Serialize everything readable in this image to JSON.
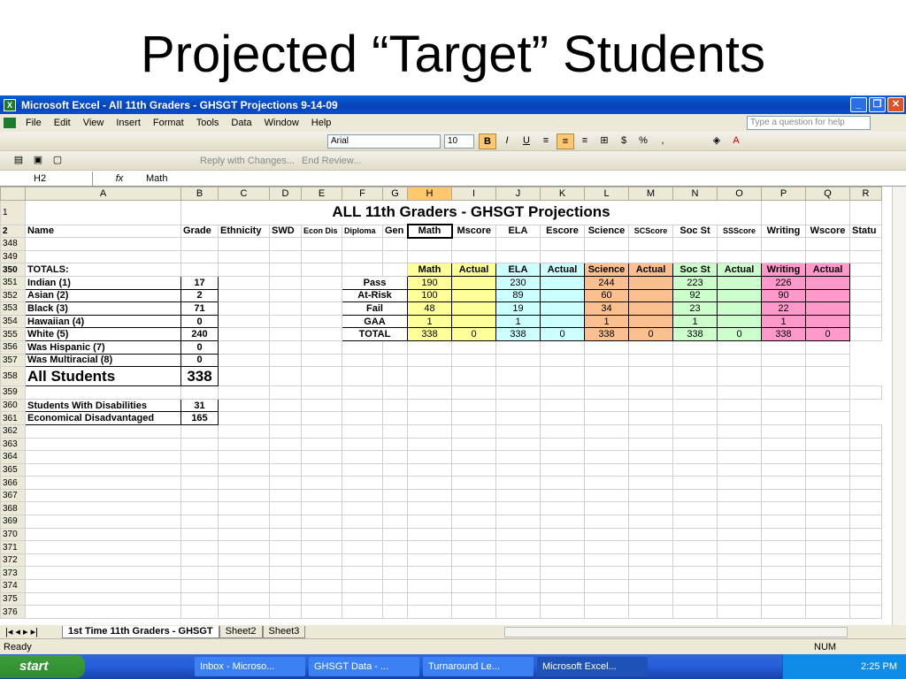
{
  "slide": {
    "title": "Projected “Target” Students"
  },
  "window": {
    "title": "Microsoft Excel - All 11th Graders - GHSGT Projections 9-14-09"
  },
  "menu": {
    "items": [
      "File",
      "Edit",
      "View",
      "Insert",
      "Format",
      "Tools",
      "Data",
      "Window",
      "Help"
    ],
    "help_placeholder": "Type a question for help"
  },
  "toolbar": {
    "font": "Arial",
    "size": "10",
    "reply": "Reply with Changes...",
    "end_review": "End Review..."
  },
  "formula_bar": {
    "cell": "H2",
    "fx": "fx",
    "value": "Math"
  },
  "sheet": {
    "col_letters": [
      "A",
      "B",
      "C",
      "D",
      "E",
      "F",
      "G",
      "H",
      "I",
      "J",
      "K",
      "L",
      "M",
      "N",
      "O",
      "P",
      "Q",
      "R"
    ],
    "row1_title": "ALL 11th Graders - GHSGT Projections",
    "headers": [
      "Name",
      "Grade",
      "Ethnicity",
      "SWD",
      "Econ Dis",
      "Diploma",
      "Gen",
      "Math",
      "Mscore",
      "ELA",
      "Escore",
      "Science",
      "SCScore",
      "Soc St",
      "SSScore",
      "Writing",
      "Wscore",
      "Statu"
    ],
    "totals_label": "TOTALS:",
    "sub_headers": [
      "Math",
      "Actual",
      "ELA",
      "Actual",
      "Science",
      "Actual",
      "Soc St",
      "Actual",
      "Writing",
      "Actual"
    ],
    "ethnic_rows": [
      {
        "row": "351",
        "label": "Indian (1)",
        "val": "17"
      },
      {
        "row": "352",
        "label": "Asian (2)",
        "val": "2"
      },
      {
        "row": "353",
        "label": "Black (3)",
        "val": "71"
      },
      {
        "row": "354",
        "label": "Hawaiian (4)",
        "val": "0"
      },
      {
        "row": "355",
        "label": "White (5)",
        "val": "240"
      }
    ],
    "proj_rows": [
      {
        "label": "Pass",
        "math": "190",
        "ela": "230",
        "sci": "244",
        "soc": "223",
        "wri": "226"
      },
      {
        "label": "At-Risk",
        "math": "100",
        "ela": "89",
        "sci": "60",
        "soc": "92",
        "wri": "90"
      },
      {
        "label": "Fail",
        "math": "48",
        "ela": "19",
        "sci": "34",
        "soc": "23",
        "wri": "22"
      },
      {
        "label": "GAA",
        "math": "1",
        "ela": "1",
        "sci": "1",
        "soc": "1",
        "wri": "1"
      }
    ],
    "total_row": {
      "label": "TOTAL",
      "math": "338",
      "ma": "0",
      "ela": "338",
      "ea": "0",
      "sci": "338",
      "sa": "0",
      "soc": "338",
      "oa": "0",
      "wri": "338",
      "wa": "0"
    },
    "hisp": {
      "label": "Was Hispanic (7)",
      "val": "0"
    },
    "multi": {
      "label": "Was Multiracial (8)",
      "val": "0"
    },
    "all": {
      "label": "All Students",
      "val": "338"
    },
    "swd": {
      "label": "Students With Disabilities",
      "val": "31"
    },
    "econ": {
      "label": "Economical Disadvantaged",
      "val": "165"
    },
    "row_numbers": {
      "r1": "1",
      "r2": "2",
      "r348": "348",
      "r349": "349",
      "r350": "350",
      "r356": "356",
      "r357": "357",
      "r358": "358",
      "r359": "359",
      "r360": "360",
      "r361": "361"
    },
    "empty_rows": [
      "362",
      "363",
      "364",
      "365",
      "366",
      "367",
      "368",
      "369",
      "370",
      "371",
      "372",
      "373",
      "374",
      "375",
      "376"
    ]
  },
  "tabs": [
    "1st Time 11th Graders - GHSGT",
    "Sheet2",
    "Sheet3"
  ],
  "status": {
    "left": "Ready",
    "num": "NUM"
  },
  "taskbar": {
    "start": "start",
    "buttons": [
      "Inbox - Microso...",
      "GHSGT Data - ...",
      "Turnaround Le...",
      "Microsoft Excel..."
    ],
    "clock": "2:25 PM"
  }
}
